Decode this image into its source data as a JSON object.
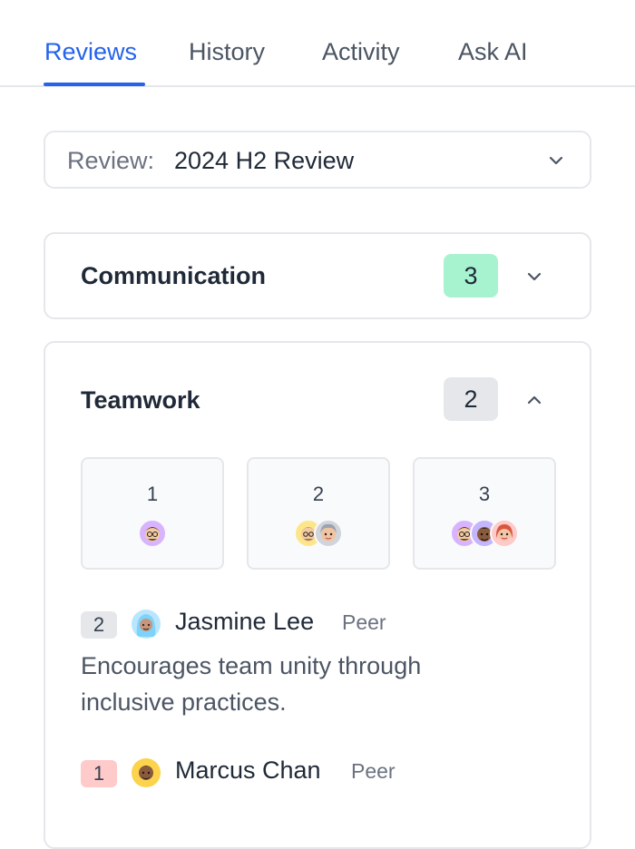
{
  "tabs": [
    {
      "label": "Reviews",
      "active": true
    },
    {
      "label": "History",
      "active": false
    },
    {
      "label": "Activity",
      "active": false
    },
    {
      "label": "Ask AI",
      "active": false
    }
  ],
  "review_select": {
    "label": "Review:",
    "value": "2024 H2 Review"
  },
  "communication": {
    "title": "Communication",
    "score": "3",
    "score_color": "#a7f3d0",
    "expanded": false
  },
  "teamwork": {
    "title": "Teamwork",
    "score": "2",
    "score_color": "#e5e7eb",
    "expanded": true,
    "distribution": [
      {
        "score": "1",
        "avatars": [
          "memoji-glasses-icon"
        ]
      },
      {
        "score": "2",
        "avatars": [
          "memoji-blond-icon",
          "memoji-grey-hair-icon"
        ]
      },
      {
        "score": "3",
        "avatars": [
          "memoji-glasses-icon",
          "memoji-dark-icon",
          "memoji-red-hair-icon"
        ]
      }
    ],
    "reviews": [
      {
        "score": "2",
        "score_color": "#e5e7eb",
        "name": "Jasmine Lee",
        "role": "Peer",
        "avatar": "memoji-hijab-icon",
        "text": "Encourages team unity through inclusive practices."
      },
      {
        "score": "1",
        "score_color": "#fecaca",
        "name": "Marcus Chan",
        "role": "Peer",
        "avatar": "memoji-beard-icon",
        "text": ""
      }
    ]
  }
}
